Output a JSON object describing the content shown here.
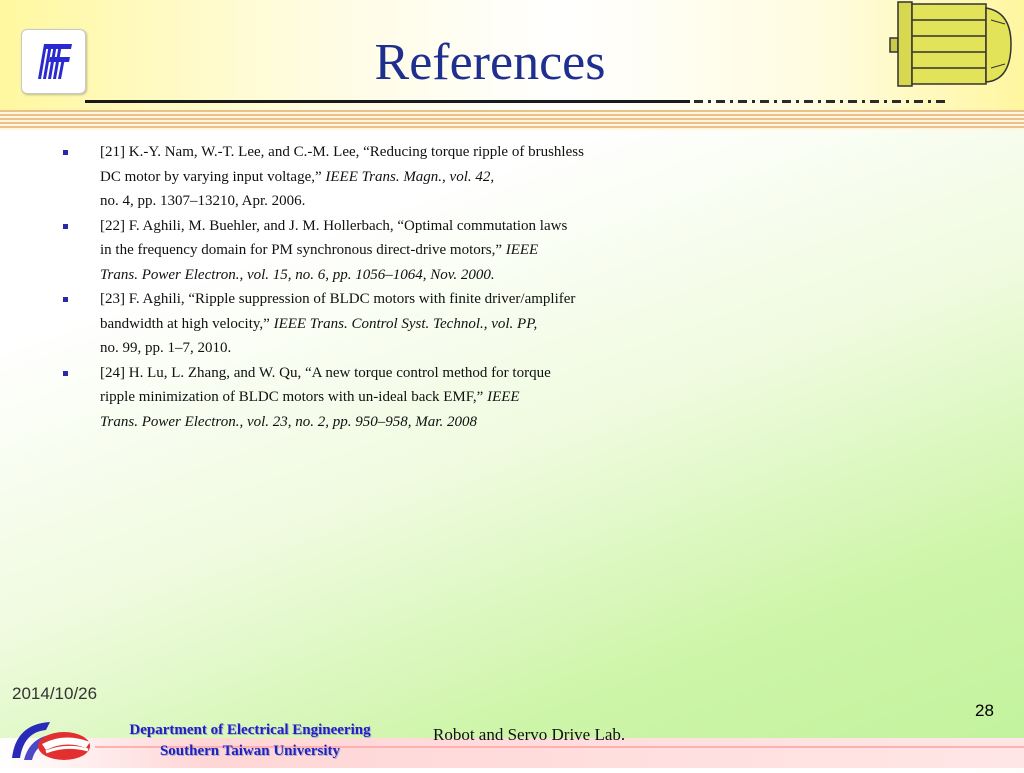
{
  "slide": {
    "title": "References",
    "date": "2014/10/26",
    "page_number": "28",
    "lab": "Robot and Servo Drive Lab.",
    "department": "Department of Electrical Engineering",
    "university": "Southern Taiwan University"
  },
  "references": [
    {
      "line1": "[21] K.-Y. Nam, W.-T. Lee, and C.-M. Lee, “Reducing torque ripple of brushless",
      "line2_plain": "DC motor by varying input voltage,” ",
      "line2_italic": "IEEE Trans. Magn., vol. 42,",
      "line3_plain": "no. 4, pp. 1307–13210, Apr. 2006.",
      "line3_italic": ""
    },
    {
      "line1": "[22] F. Aghili, M. Buehler, and J. M. Hollerbach, “Optimal commutation laws",
      "line2_plain": "in the frequency domain for PM synchronous direct-drive motors,” ",
      "line2_italic": "IEEE",
      "line3_plain": "",
      "line3_italic": "Trans. Power Electron., vol. 15, no. 6, pp. 1056–1064, Nov. 2000."
    },
    {
      "line1": "[23] F. Aghili, “Ripple suppression of BLDC motors with finite driver/amplifer",
      "line2_plain": "bandwidth at high velocity,” ",
      "line2_italic": "IEEE Trans. Control Syst. Technol., vol. PP,",
      "line3_plain": "no. 99, pp. 1–7, 2010.",
      "line3_italic": ""
    },
    {
      "line1": "[24] H. Lu, L. Zhang, and W. Qu, “A new torque control method for torque",
      "line2_plain": "ripple minimization of BLDC motors with un-ideal back EMF,” ",
      "line2_italic": "IEEE",
      "line3_plain": "",
      "line3_italic": "Trans. Power Electron., vol. 23, no. 2, pp. 950–958, Mar. 2008"
    }
  ],
  "icons": {
    "header_logo": "university-logo-icon",
    "motor": "electric-motor-icon",
    "footer_logo": "department-logo-icon",
    "bullet": "square-bullet-icon"
  },
  "colors": {
    "title": "#1f2f8f",
    "bullet": "#2a2aa8",
    "department_text": "#2020c0"
  }
}
